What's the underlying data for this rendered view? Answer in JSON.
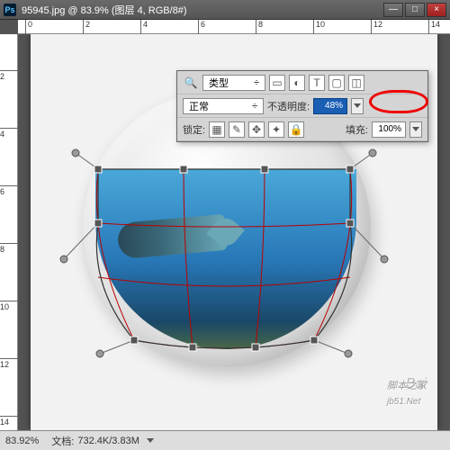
{
  "title": "95945.jpg @ 83.9% (图层 4, RGB/8#)",
  "window_buttons": {
    "min": "—",
    "max": "□",
    "close": "×"
  },
  "ruler_h": [
    "0",
    "2",
    "4",
    "6",
    "8",
    "10",
    "12",
    "14"
  ],
  "ruler_v": [
    "2",
    "4",
    "6",
    "8",
    "10",
    "12",
    "14"
  ],
  "layers": {
    "kind_label": "类型",
    "kind_icons": [
      "▭",
      "◐",
      "T",
      "▢",
      "◫"
    ],
    "blend_mode": "正常",
    "opacity_label": "不透明度:",
    "opacity_value": "48%",
    "lock_label": "锁定:",
    "lock_icons": [
      "▦",
      "✎",
      "✥",
      "✦",
      "🔒"
    ],
    "fill_label": "填充:",
    "fill_value": "100%"
  },
  "status": {
    "zoom": "83.92%",
    "doc_label": "文档:",
    "doc_value": "732.4K/3.83M"
  },
  "watermarks": {
    "w1": "Bai",
    "w2": "脚本之家",
    "w3": "jb51.Net"
  }
}
